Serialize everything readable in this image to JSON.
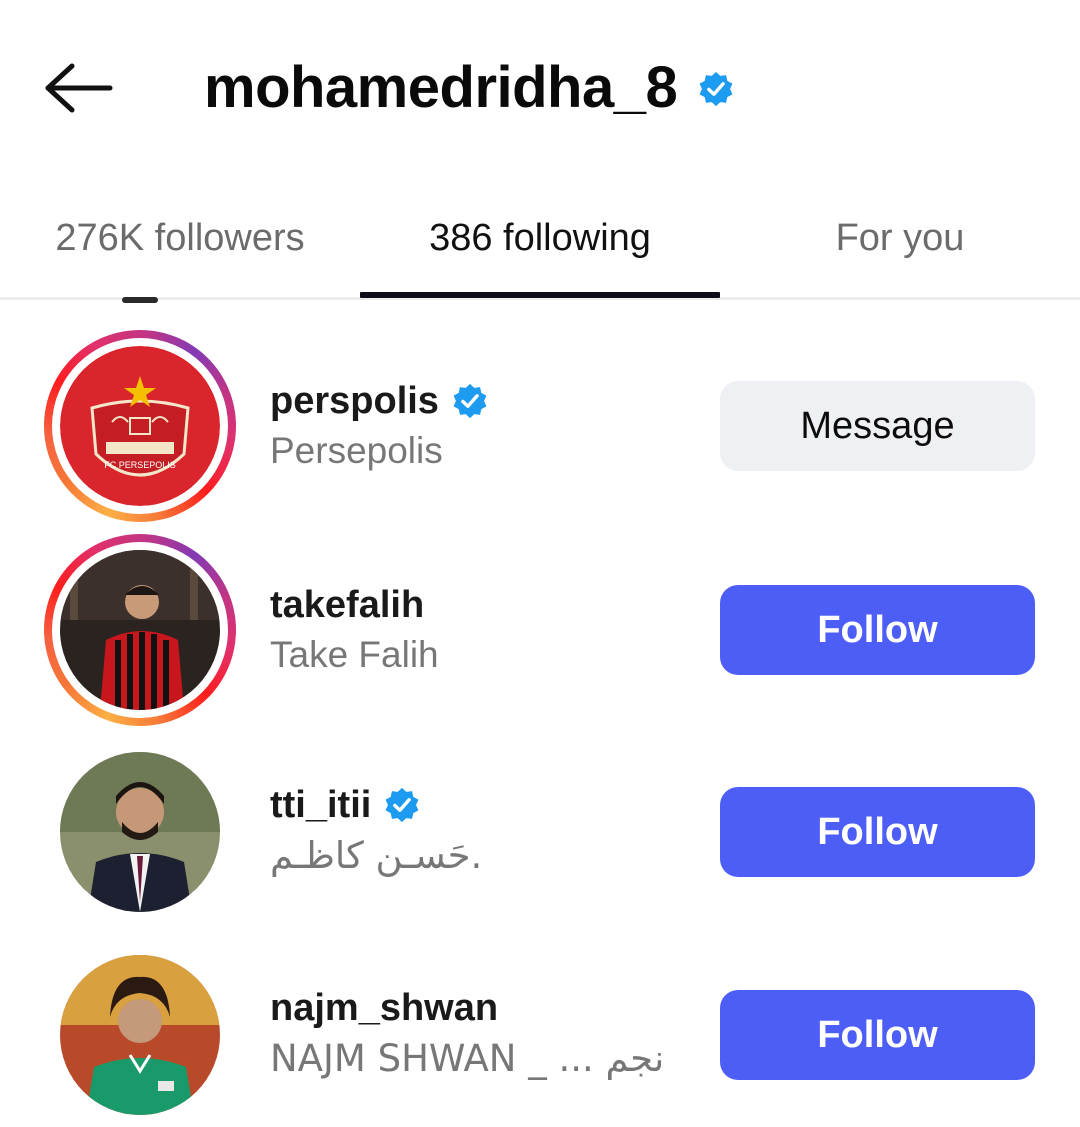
{
  "header": {
    "title": "mohamedridha_8",
    "verified": true
  },
  "tabs": [
    {
      "label": "276K followers",
      "active": false
    },
    {
      "label": "386 following",
      "active": true
    },
    {
      "label": "For you",
      "active": false
    }
  ],
  "list": [
    {
      "username": "perspolis",
      "full_name": "Persepolis",
      "verified": true,
      "story_ring": true,
      "button": "Message",
      "button_style": "message",
      "avatar_text": "FC PERSEPOLIS"
    },
    {
      "username": "takefalih",
      "full_name": "Take Falih",
      "verified": false,
      "story_ring": true,
      "button": "Follow",
      "button_style": "follow"
    },
    {
      "username": "tti_itii",
      "full_name": "حَسـن كاظـم.",
      "verified": true,
      "story_ring": false,
      "button": "Follow",
      "button_style": "follow"
    },
    {
      "username": "najm_shwan",
      "full_name": "NAJM SHWAN _ ... نجم",
      "verified": false,
      "story_ring": false,
      "button": "Follow",
      "button_style": "follow"
    }
  ],
  "colors": {
    "verified_blue": "#1d9bf0",
    "follow_button": "#4d5ef7",
    "message_button": "#eff0f4",
    "tab_indicator": "#0d0d1a"
  },
  "icons": {
    "back": "arrow-left-icon",
    "verified": "verified-badge-icon"
  }
}
